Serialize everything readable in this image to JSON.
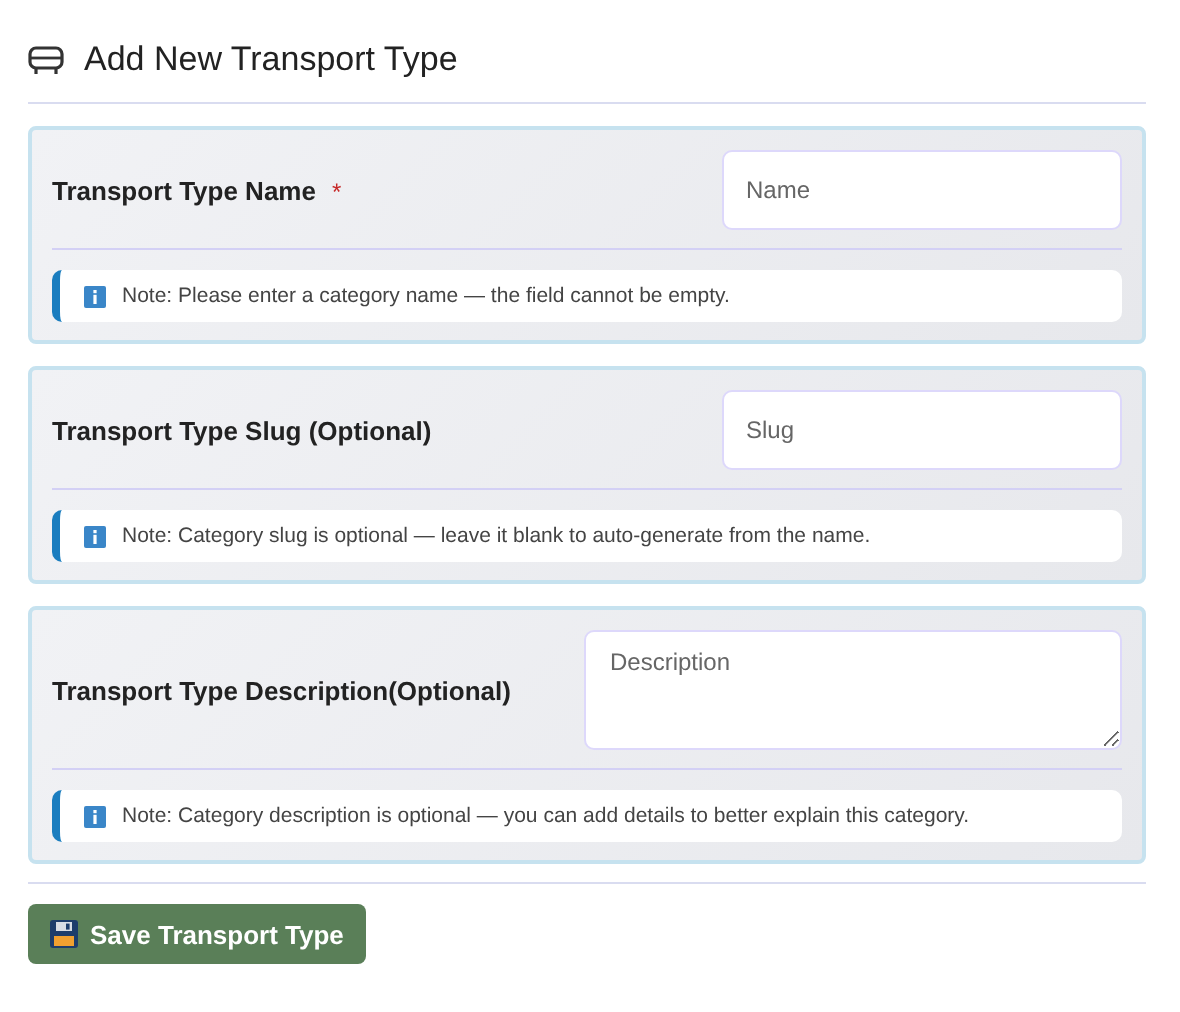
{
  "header": {
    "title": "Add New Transport Type"
  },
  "fields": [
    {
      "kind": "input",
      "label": "Transport Type Name",
      "required_mark": "*",
      "placeholder": "Name",
      "note": "Note: Please enter a category name — the field cannot be empty."
    },
    {
      "kind": "input",
      "label": "Transport Type Slug (Optional)",
      "placeholder": "Slug",
      "note": "Note: Category slug is optional — leave it blank to auto-generate from the name."
    },
    {
      "kind": "textarea",
      "label": "Transport Type Description(Optional)",
      "placeholder": "Description",
      "note": "Note: Category description is optional — you can add details to better explain this category."
    }
  ],
  "save_button": {
    "label": "Save Transport Type"
  }
}
